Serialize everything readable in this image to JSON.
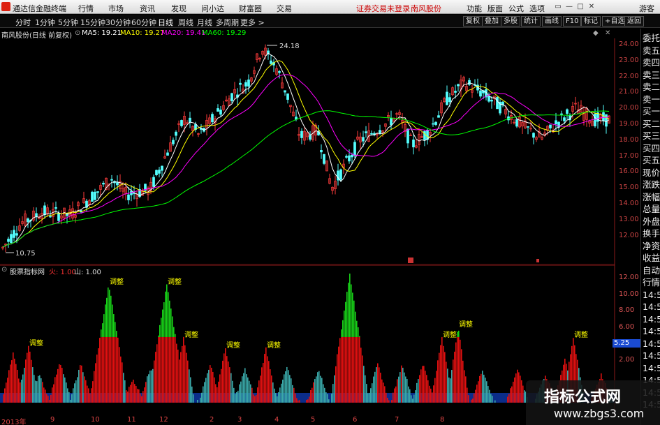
{
  "menubar": {
    "app_title": "通达信金融终端",
    "menus": [
      "行情",
      "市场",
      "资讯",
      "发现",
      "问小达",
      "财富圈",
      "交易"
    ],
    "notice": "证券交易未登录",
    "stock": "南风股份",
    "right_menus": [
      "功能",
      "版面",
      "公式",
      "选项"
    ],
    "guest": "游客"
  },
  "toolbar": {
    "periods": [
      "分时",
      "1分钟",
      "5分钟",
      "15分钟",
      "30分钟",
      "60分钟",
      "日线",
      "周线",
      "月线",
      "多周期",
      "更多 >"
    ],
    "active_period": "日线",
    "buttons": [
      "复权",
      "叠加",
      "多股",
      "统计",
      "画线",
      "F10",
      "标记",
      "+自选",
      "返回"
    ]
  },
  "legend": {
    "stock_label": "南风股份(日线 前复权)",
    "ma5": "MA5: 19.21",
    "ma10": "MA10: 19.27",
    "ma20": "MA20: 19.41",
    "ma60": "MA60: 19.29",
    "colors": {
      "ma5": "#ffffff",
      "ma10": "#ffff00",
      "ma20": "#ff00ff",
      "ma60": "#00ff00"
    }
  },
  "price_axis": [
    "24.00",
    "23.00",
    "22.00",
    "21.00",
    "20.00",
    "19.00",
    "18.00",
    "17.00",
    "16.00",
    "15.00",
    "14.00",
    "13.00",
    "12.00"
  ],
  "price_high_label": "24.18",
  "price_low_label": "10.75",
  "sidebar": [
    "委托",
    "卖五",
    "卖四",
    "卖三",
    "卖二",
    "卖一",
    "买一",
    "买二",
    "买三",
    "买四",
    "买五",
    "现价",
    "涨跌",
    "涨幅",
    "总量",
    "外盘",
    "换手",
    "净资",
    "收益",
    "自动",
    "行情",
    "14:5",
    "14:5",
    "14:5",
    "14:5",
    "14:5",
    "14:5",
    "14:5",
    "14:5",
    "14:5",
    "14:5"
  ],
  "sub_legend": {
    "name": "股票指标网",
    "item1": "火: 1.00",
    "item2": "山: 1.00"
  },
  "sub_axis": [
    "12.00",
    "10.00",
    "8.00",
    "6.00",
    "4.00",
    "2.00"
  ],
  "sub_current": "5.25",
  "sub_label": "调整",
  "xaxis": [
    "2013年",
    "9",
    "10",
    "11",
    "12",
    "2",
    "3",
    "4",
    "5",
    "6",
    "7",
    "8"
  ],
  "watermark": {
    "line1": "指标公式网",
    "line2": "www.zbgs3.com"
  }
}
